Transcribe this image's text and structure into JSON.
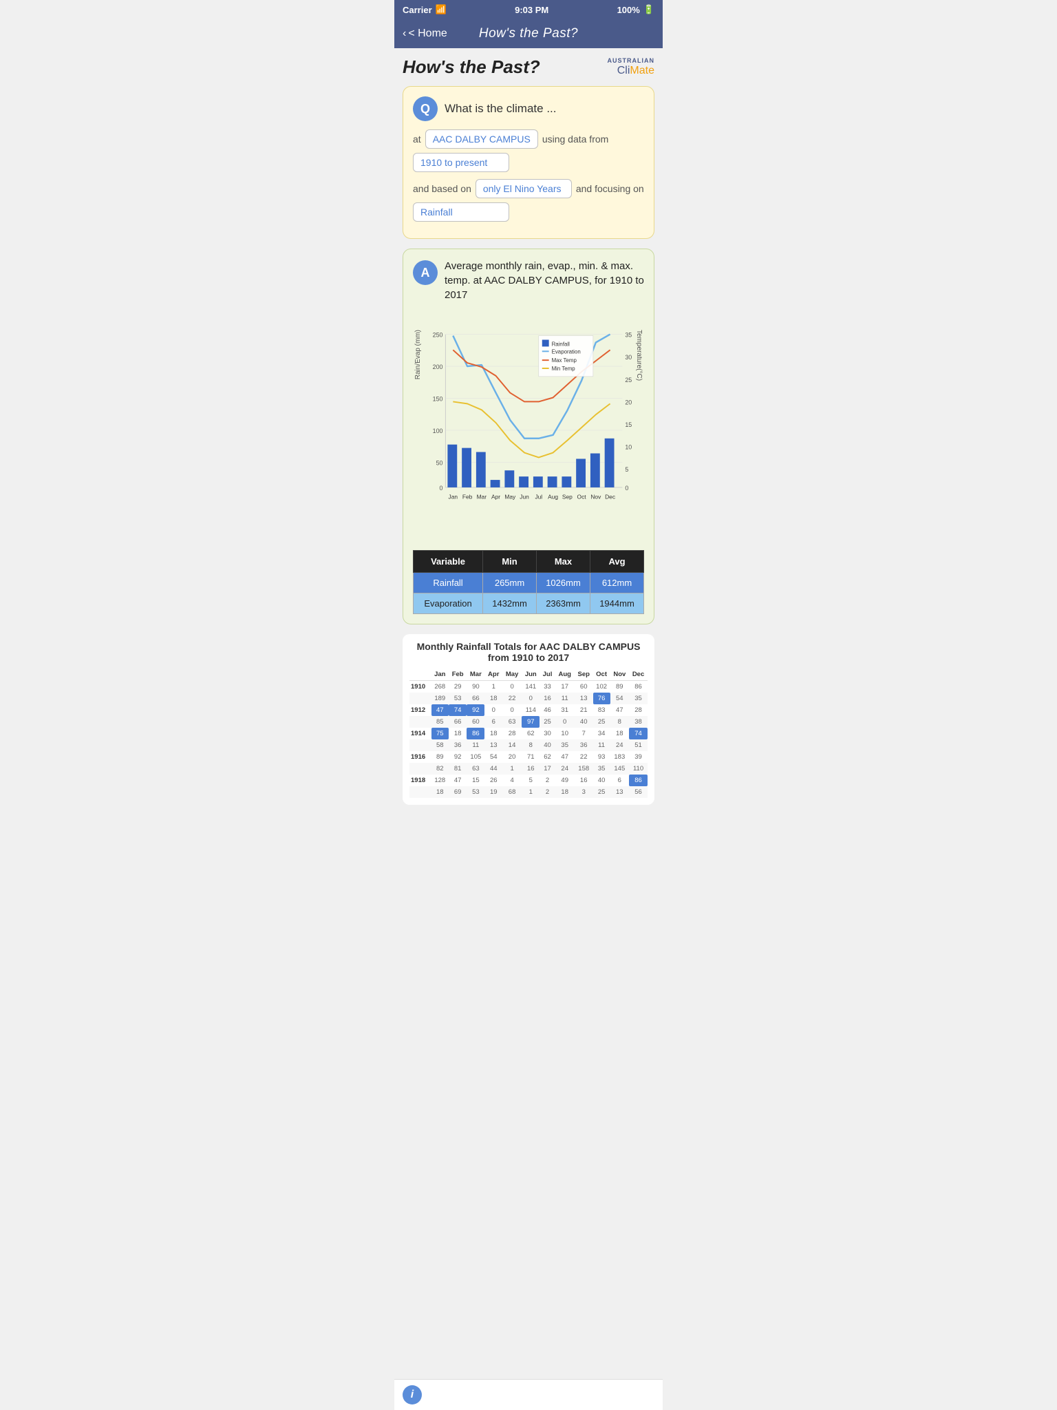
{
  "statusBar": {
    "carrier": "Carrier",
    "wifi": "wifi",
    "time": "9:03 PM",
    "battery": "100%"
  },
  "navBar": {
    "back_label": "< Home",
    "title": "How's the Past?"
  },
  "page": {
    "title": "How's the Past?",
    "brand": {
      "line1": "AUSTRALIAN",
      "cli": "Cli",
      "mate": "Mate"
    }
  },
  "question": {
    "icon": "Q",
    "text": "What is the climate ...",
    "at_label": "at",
    "station": "AAC DALBY CAMPUS",
    "using_label": "using data from",
    "date_range": "1910 to present",
    "based_label": "and based on",
    "filter": "only El Nino Years",
    "focusing_label": "and focusing on",
    "focus": "Rainfall"
  },
  "answer": {
    "icon": "A",
    "title": "Average monthly rain, evap., min. & max. temp. at AAC DALBY CAMPUS, for 1910 to 2017"
  },
  "chart": {
    "yLeftLabel": "Rain/Evap (mm)",
    "yRightLabel": "Temperature(°C)",
    "leftAxis": [
      250,
      200,
      150,
      100,
      50,
      0
    ],
    "rightAxis": [
      35,
      30,
      25,
      20,
      15,
      10,
      5,
      0
    ],
    "months": [
      "Jan",
      "Feb",
      "Mar",
      "Apr",
      "May",
      "Jun",
      "Jul",
      "Aug",
      "Sep",
      "Oct",
      "Nov",
      "Dec"
    ],
    "rainfall": [
      70,
      65,
      58,
      12,
      28,
      18,
      18,
      18,
      18,
      47,
      55,
      80
    ],
    "evaporation": [
      248,
      198,
      200,
      155,
      110,
      80,
      80,
      85,
      125,
      175,
      225,
      250
    ],
    "maxTemp": [
      235,
      218,
      205,
      185,
      160,
      148,
      148,
      155,
      175,
      195,
      218,
      240
    ],
    "minTemp": [
      145,
      140,
      128,
      108,
      80,
      60,
      55,
      60,
      75,
      95,
      118,
      140
    ],
    "legend": [
      {
        "label": "Rainfall",
        "color": "#3060c0"
      },
      {
        "label": "Evaporation",
        "color": "#6ab0e8"
      },
      {
        "label": "Max Temp",
        "color": "#e06030"
      },
      {
        "label": "Min Temp",
        "color": "#e8c030"
      }
    ]
  },
  "summaryTable": {
    "headers": [
      "Variable",
      "Min",
      "Max",
      "Avg"
    ],
    "rows": [
      {
        "variable": "Rainfall",
        "min": "265mm",
        "max": "1026mm",
        "avg": "612mm",
        "rowClass": "blue"
      },
      {
        "variable": "Evaporation",
        "min": "1432mm",
        "max": "2363mm",
        "avg": "1944mm",
        "rowClass": "lightblue"
      }
    ]
  },
  "monthlyTable": {
    "title": "Monthly Rainfall Totals for AAC DALBY CAMPUS from 1910 to 2017",
    "headers": [
      "",
      "Jan",
      "Feb",
      "Mar",
      "Apr",
      "May",
      "Jun",
      "Jul",
      "Aug",
      "Sep",
      "Oct",
      "Nov",
      "Dec"
    ],
    "rows": [
      {
        "year": "1910",
        "values": [
          "268",
          "29",
          "90",
          "1",
          "0",
          "141",
          "33",
          "17",
          "60",
          "102",
          "89",
          "86"
        ],
        "highlights": []
      },
      {
        "year": "",
        "values": [
          "189",
          "53",
          "66",
          "18",
          "22",
          "0",
          "16",
          "11",
          "13",
          "76",
          "54",
          "35"
        ],
        "highlights": [
          9
        ]
      },
      {
        "year": "1912",
        "values": [
          "47",
          "74",
          "92",
          "0",
          "0",
          "114",
          "46",
          "31",
          "21",
          "83",
          "47",
          "28"
        ],
        "highlights": [
          0,
          1,
          2
        ]
      },
      {
        "year": "",
        "values": [
          "85",
          "66",
          "60",
          "6",
          "63",
          "97",
          "25",
          "0",
          "40",
          "25",
          "8",
          "38"
        ],
        "highlights": [
          5
        ]
      },
      {
        "year": "1914",
        "values": [
          "75",
          "18",
          "86",
          "18",
          "28",
          "62",
          "30",
          "10",
          "7",
          "34",
          "18",
          "74"
        ],
        "highlights": [
          0,
          2,
          11
        ]
      },
      {
        "year": "",
        "values": [
          "58",
          "36",
          "11",
          "13",
          "14",
          "8",
          "40",
          "35",
          "36",
          "11",
          "24",
          "51"
        ],
        "highlights": []
      },
      {
        "year": "1916",
        "values": [
          "89",
          "92",
          "105",
          "54",
          "20",
          "71",
          "62",
          "47",
          "22",
          "93",
          "183",
          "39"
        ],
        "highlights": []
      },
      {
        "year": "",
        "values": [
          "82",
          "81",
          "63",
          "44",
          "1",
          "16",
          "17",
          "24",
          "158",
          "35",
          "145",
          "110"
        ],
        "highlights": []
      },
      {
        "year": "1918",
        "values": [
          "128",
          "47",
          "15",
          "26",
          "4",
          "5",
          "2",
          "49",
          "16",
          "40",
          "6",
          "86"
        ],
        "highlights": [
          11
        ]
      },
      {
        "year": "",
        "values": [
          "18",
          "69",
          "53",
          "19",
          "68",
          "1",
          "2",
          "18",
          "3",
          "25",
          "13",
          "56"
        ],
        "highlights": []
      }
    ]
  }
}
